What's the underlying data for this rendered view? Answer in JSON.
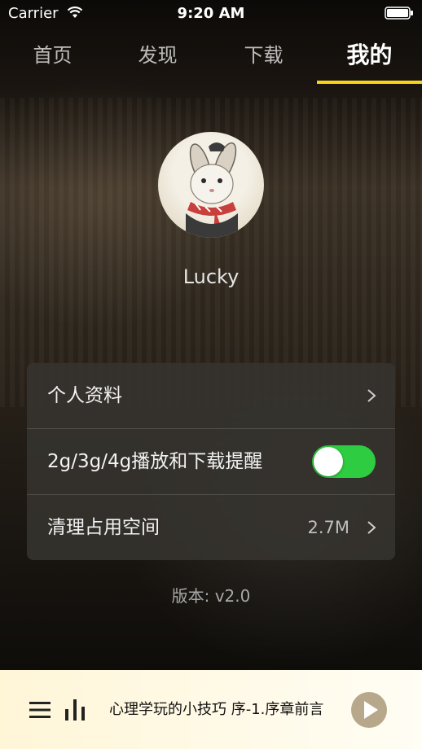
{
  "status_bar": {
    "carrier": "Carrier",
    "time": "9:20 AM"
  },
  "tabs": [
    {
      "label": "首页",
      "active": false
    },
    {
      "label": "发现",
      "active": false
    },
    {
      "label": "下载",
      "active": false
    },
    {
      "label": "我的",
      "active": true
    }
  ],
  "colors": {
    "accent": "#f6d51b",
    "toggle_on": "#2ecc40",
    "player_bg": "#fff6d8"
  },
  "profile": {
    "name": "Lucky"
  },
  "settings": {
    "profile_label": "个人资料",
    "network_label": "2g/3g/4g播放和下载提醒",
    "network_toggle_on": true,
    "cache_label": "清理占用空间",
    "cache_value": "2.7M"
  },
  "version": "版本: v2.0",
  "player": {
    "track_title": "心理学玩的小技巧 序-1.序章前言"
  },
  "icons": [
    "wifi-icon",
    "battery-icon",
    "chevron-right-icon",
    "menu-icon",
    "equalizer-icon",
    "play-icon"
  ]
}
